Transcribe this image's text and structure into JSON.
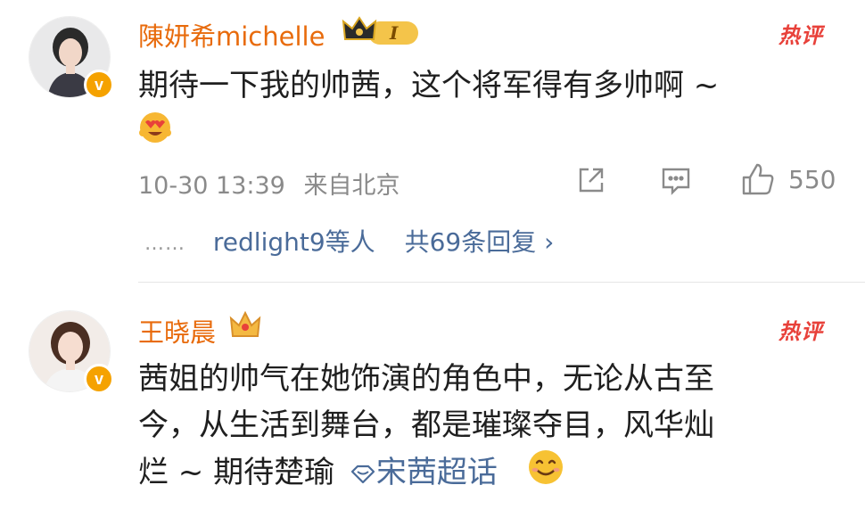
{
  "comments": [
    {
      "username": "陳妍希michelle",
      "hot_label": "热评",
      "text_line1": "期待一下我的帅茜，这个将军得有多帅啊 ~",
      "timestamp": "10-30 13:39",
      "location": "来自北京",
      "like_count": "550",
      "reply_preview": {
        "dots": "……",
        "who": "redlight9等人",
        "count_text": "共69条回复 ›"
      },
      "badge_level": "I",
      "icons": [
        "avatar",
        "verified-badge",
        "crown-badge",
        "heart-eyes-emoji",
        "share-icon",
        "comment-icon",
        "like-icon"
      ]
    },
    {
      "username": "王晓晨",
      "hot_label": "热评",
      "text_line1": "茜姐的帅气在她饰演的角色中，无论从古至",
      "text_line2": "今，从生活到舞台，都是璀璨夺目，风华灿",
      "text_line3_prefix": "烂 ~ 期待楚瑜",
      "topic": "宋茜超话",
      "icons": [
        "avatar",
        "verified-badge",
        "crown-badge",
        "topic-icon",
        "smile-emoji"
      ]
    }
  ],
  "colors": {
    "username": "#e86b0c",
    "hot": "#e8413a",
    "link": "#4a6b99",
    "meta": "#8a8a8a",
    "verified": "#f5a200"
  }
}
